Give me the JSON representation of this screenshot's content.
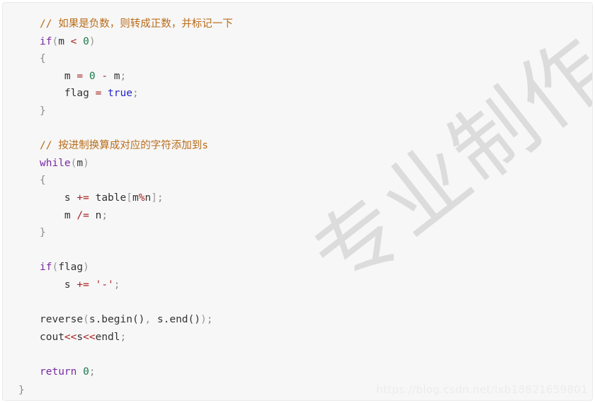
{
  "card": {
    "background_color": "#f7f7f7",
    "border_color": "#eaeaea",
    "language": "cpp"
  },
  "palette": {
    "comment": "#b86c1a",
    "keyword": "#7928a1",
    "identifier": "#333333",
    "operator": "#aa2222",
    "number": "#1a7a4c",
    "boolean": "#2222cc",
    "string": "#aa2222",
    "punctuation": "#999999",
    "brace": "#8c8c8c",
    "background": "#f7f7f7",
    "watermark": "#dcdcdc"
  },
  "code": {
    "line_01": {
      "comment": "// 如果是负数，则转成正数，并标记一下"
    },
    "line_02": {
      "kw": "if",
      "open": "(",
      "ident": "m",
      "op": "<",
      "num": "0",
      "close": ")"
    },
    "line_03": {
      "brace": "{"
    },
    "line_04": {
      "ident": "m",
      "op1": "=",
      "num": "0",
      "op2": "-",
      "ident2": "m",
      "semi": ";"
    },
    "line_05": {
      "ident": "flag",
      "op": "=",
      "bool": "true",
      "semi": ";"
    },
    "line_06": {
      "brace": "}"
    },
    "line_07": {
      "blank": " "
    },
    "line_08": {
      "comment": "// 按进制换算成对应的字符添加到s"
    },
    "line_09": {
      "kw": "while",
      "open": "(",
      "ident": "m",
      "close": ")"
    },
    "line_10": {
      "brace": "{"
    },
    "line_11": {
      "ident": "s",
      "op": "+=",
      "ident2": "table",
      "lb": "[",
      "ident3": "m",
      "mod": "%",
      "ident4": "n",
      "rb": "]",
      "semi": ";"
    },
    "line_12": {
      "ident": "m",
      "op": "/=",
      "ident2": "n",
      "semi": ";"
    },
    "line_13": {
      "brace": "}"
    },
    "line_14": {
      "blank": " "
    },
    "line_15": {
      "kw": "if",
      "open": "(",
      "ident": "flag",
      "close": ")"
    },
    "line_16": {
      "ident": "s",
      "op": "+=",
      "str": "'-'",
      "semi": ";"
    },
    "line_17": {
      "blank": " "
    },
    "line_18": {
      "ident": "reverse",
      "open": "(",
      "a1": "s.begin()",
      "comma": ",",
      "a2": "s.end()",
      "close": ")",
      "semi": ";"
    },
    "line_19": {
      "ident": "cout",
      "op1": "<<",
      "ident2": "s",
      "op2": "<<",
      "ident3": "endl",
      "semi": ";"
    },
    "line_20": {
      "blank": " "
    },
    "line_21": {
      "kw": "return",
      "num": "0",
      "semi": ";"
    },
    "line_22": {
      "brace": "}"
    }
  },
  "watermarks": {
    "diagonal_text": "专业制作",
    "url_text": "https://blog.csdn.net/lxb18821659801"
  }
}
